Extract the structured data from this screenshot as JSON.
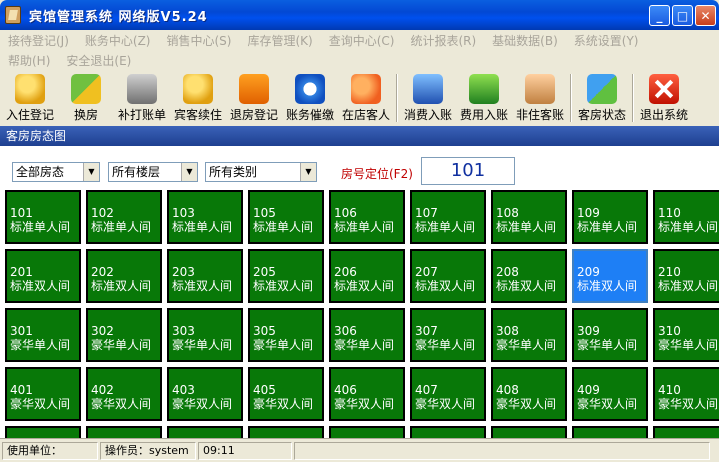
{
  "window": {
    "title": "宾馆管理系统 网络版V5.24"
  },
  "menu": {
    "row1": [
      "接待登记(J)",
      "账务中心(Z)",
      "销售中心(S)",
      "库存管理(K)",
      "查询中心(C)",
      "统计报表(R)",
      "基础数据(B)",
      "系统设置(Y)"
    ],
    "row2": [
      "帮助(H)",
      "安全退出(E)"
    ]
  },
  "toolbar": {
    "buttons": [
      {
        "label": "入住登记",
        "icon": "key-icon"
      },
      {
        "label": "换房",
        "icon": "swap-room-icon"
      },
      {
        "label": "补打账单",
        "icon": "printer-icon"
      },
      {
        "label": "宾客续住",
        "icon": "key-extend-icon"
      },
      {
        "label": "退房登记",
        "icon": "checkout-icon"
      },
      {
        "label": "账务催缴",
        "icon": "clock-icon"
      },
      {
        "label": "在店客人",
        "icon": "guests-icon"
      },
      {
        "label": "消费入账",
        "icon": "yen-icon"
      },
      {
        "label": "费用入账",
        "icon": "checkmark-icon"
      },
      {
        "label": "非住客账",
        "icon": "person-icon"
      },
      {
        "label": "客房状态",
        "icon": "room-status-icon"
      },
      {
        "label": "退出系统",
        "icon": "exit-icon"
      }
    ]
  },
  "panel": {
    "title": "客房房态图"
  },
  "filters": {
    "status": "全部房态",
    "floor": "所有楼层",
    "category": "所有类别",
    "locate_label": "房号定位(F2)",
    "locate_value": "101"
  },
  "rooms": [
    [
      {
        "no": "101",
        "type": "标准单人间"
      },
      {
        "no": "102",
        "type": "标准单人间"
      },
      {
        "no": "103",
        "type": "标准单人间"
      },
      {
        "no": "105",
        "type": "标准单人间"
      },
      {
        "no": "106",
        "type": "标准单人间"
      },
      {
        "no": "107",
        "type": "标准单人间"
      },
      {
        "no": "108",
        "type": "标准单人间"
      },
      {
        "no": "109",
        "type": "标准单人间"
      },
      {
        "no": "110",
        "type": "标准单人间"
      }
    ],
    [
      {
        "no": "201",
        "type": "标准双人间"
      },
      {
        "no": "202",
        "type": "标准双人间"
      },
      {
        "no": "203",
        "type": "标准双人间"
      },
      {
        "no": "205",
        "type": "标准双人间"
      },
      {
        "no": "206",
        "type": "标准双人间"
      },
      {
        "no": "207",
        "type": "标准双人间"
      },
      {
        "no": "208",
        "type": "标准双人间"
      },
      {
        "no": "209",
        "type": "标准双人间",
        "selected": true
      },
      {
        "no": "210",
        "type": "标准双人间"
      }
    ],
    [
      {
        "no": "301",
        "type": "豪华单人间"
      },
      {
        "no": "302",
        "type": "豪华单人间"
      },
      {
        "no": "303",
        "type": "豪华单人间"
      },
      {
        "no": "305",
        "type": "豪华单人间"
      },
      {
        "no": "306",
        "type": "豪华单人间"
      },
      {
        "no": "307",
        "type": "豪华单人间"
      },
      {
        "no": "308",
        "type": "豪华单人间"
      },
      {
        "no": "309",
        "type": "豪华单人间"
      },
      {
        "no": "310",
        "type": "豪华单人间"
      }
    ],
    [
      {
        "no": "401",
        "type": "豪华双人间"
      },
      {
        "no": "402",
        "type": "豪华双人间"
      },
      {
        "no": "403",
        "type": "豪华双人间"
      },
      {
        "no": "405",
        "type": "豪华双人间"
      },
      {
        "no": "406",
        "type": "豪华双人间"
      },
      {
        "no": "407",
        "type": "豪华双人间"
      },
      {
        "no": "408",
        "type": "豪华双人间"
      },
      {
        "no": "409",
        "type": "豪华双人间"
      },
      {
        "no": "410",
        "type": "豪华双人间"
      }
    ]
  ],
  "statusbar": {
    "unit_label": "使用单位：",
    "operator_label": "操作员：system",
    "time": "09:11"
  },
  "colors": {
    "room_vacant": "#087808",
    "room_selected": "#1e7ff5",
    "title_bar": "#0348d4"
  }
}
